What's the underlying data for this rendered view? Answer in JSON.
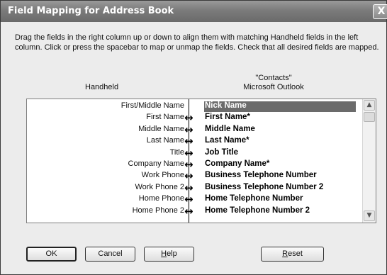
{
  "window": {
    "title": "Field Mapping for Address Book",
    "close_glyph": "X"
  },
  "instructions": "Drag the fields in the right column up or down to align them with matching Handheld fields in the left column.  Click or press the spacebar to map or unmap the fields.  Check that all desired fields are mapped.",
  "columns": {
    "left_header": "Handheld",
    "right_app_quoted": "\"Contacts\"",
    "right_app_name": "Microsoft Outlook"
  },
  "mappings": [
    {
      "handheld": "First/Middle Name",
      "mapped": false,
      "outlook": "Nick Name",
      "selected": true
    },
    {
      "handheld": "First Name",
      "mapped": true,
      "outlook": "First Name*",
      "selected": false
    },
    {
      "handheld": "Middle Name",
      "mapped": true,
      "outlook": "Middle Name",
      "selected": false
    },
    {
      "handheld": "Last Name",
      "mapped": true,
      "outlook": "Last Name*",
      "selected": false
    },
    {
      "handheld": "Title",
      "mapped": true,
      "outlook": "Job Title",
      "selected": false
    },
    {
      "handheld": "Company Name",
      "mapped": true,
      "outlook": "Company Name*",
      "selected": false
    },
    {
      "handheld": "Work Phone",
      "mapped": true,
      "outlook": "Business Telephone Number",
      "selected": false
    },
    {
      "handheld": "Work Phone 2",
      "mapped": true,
      "outlook": "Business Telephone Number 2",
      "selected": false
    },
    {
      "handheld": "Home Phone",
      "mapped": true,
      "outlook": "Home Telephone Number",
      "selected": false
    },
    {
      "handheld": "Home Phone 2",
      "mapped": true,
      "outlook": "Home Telephone Number 2",
      "selected": false
    }
  ],
  "arrow_glyph": "↔",
  "scroll": {
    "up_glyph": "▲",
    "down_glyph": "▼"
  },
  "buttons": {
    "ok": "OK",
    "cancel": "Cancel",
    "help_mnemonic": "H",
    "help_rest": "elp",
    "reset_mnemonic": "R",
    "reset_rest": "eset"
  },
  "colors": {
    "selection": "#6b6b6b",
    "titlebar": "#7b7b7b"
  }
}
